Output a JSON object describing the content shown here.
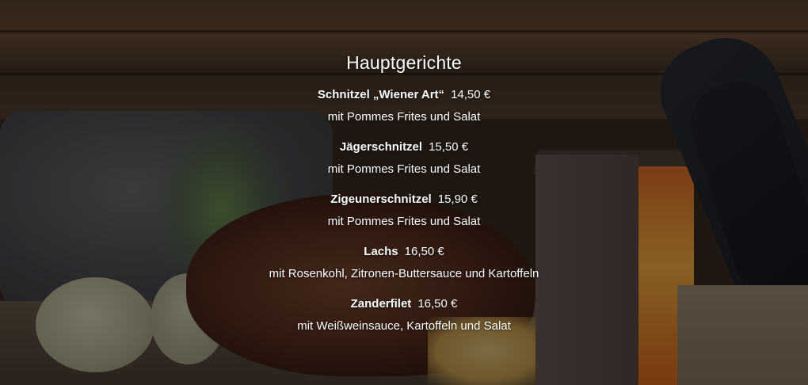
{
  "section": {
    "title": "Hauptgerichte"
  },
  "items": [
    {
      "name": "Schnitzel „Wiener Art“",
      "price": "14,50 €",
      "description": "mit Pommes Frites und Salat"
    },
    {
      "name": "Jägerschnitzel",
      "price": "15,50 €",
      "description": "mit Pommes Frites und Salat"
    },
    {
      "name": "Zigeunerschnitzel",
      "price": "15,90 €",
      "description": "mit Pommes Frites und Salat"
    },
    {
      "name": "Lachs",
      "price": "16,50 €",
      "description": "mit Rosenkohl, Zitronen-Buttersauce und Kartoffeln"
    },
    {
      "name": "Zanderfilet",
      "price": "16,50 €",
      "description": "mit Weißweinsauce, Kartoffeln und Salat"
    }
  ]
}
